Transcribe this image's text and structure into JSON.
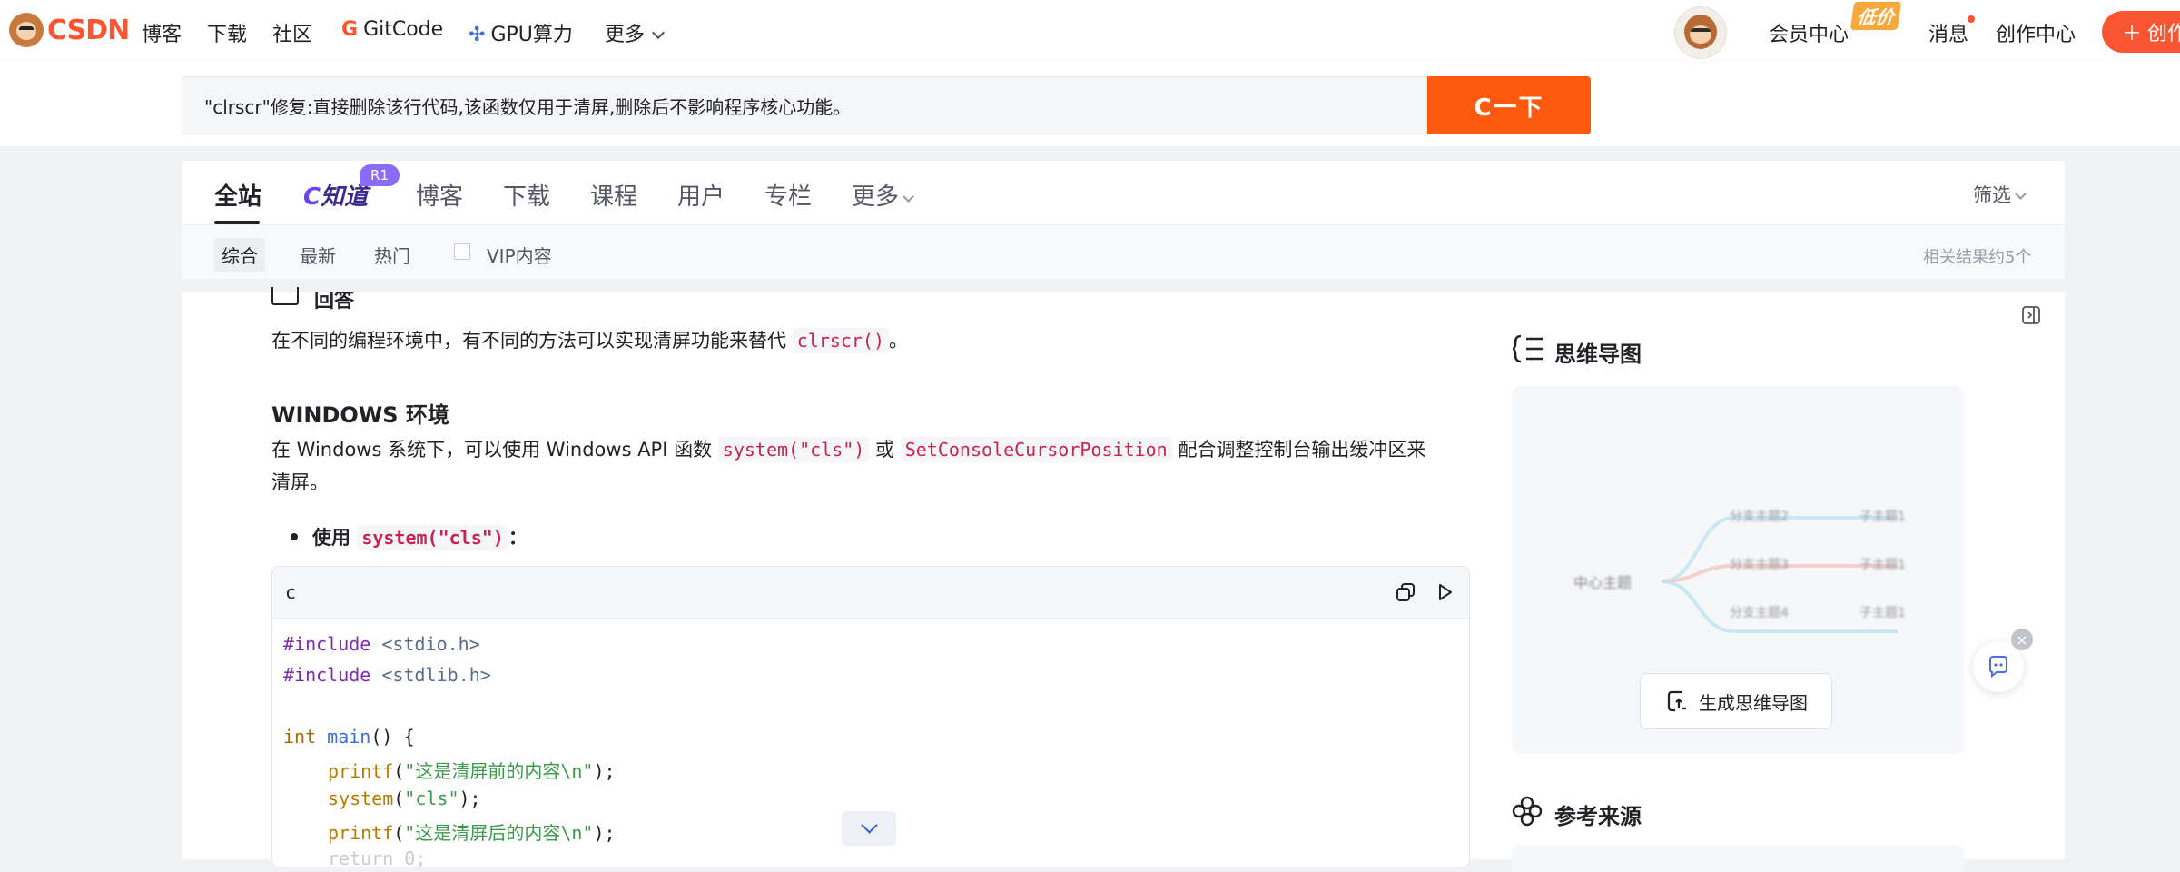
{
  "topnav": {
    "logo_text": "CSDN",
    "items": [
      "博客",
      "下载",
      "社区"
    ],
    "gitcode": "GitCode",
    "gpu": "GPU算力",
    "more": "更多",
    "member_center": "会员中心",
    "vip_badge": "低价",
    "messages": "消息",
    "creator_center": "创作中心",
    "create_button": "创作"
  },
  "search": {
    "query": "\"clrscr\"修复:直接删除该行代码,该函数仅用于清屏,删除后不影响程序核心功能。",
    "button": "C一下"
  },
  "tabs": {
    "all": "全站",
    "zhidao": "知道",
    "zhidao_badge": "R1",
    "blog": "博客",
    "download": "下载",
    "course": "课程",
    "user": "用户",
    "column": "专栏",
    "more": "更多",
    "filter": "筛选"
  },
  "subfilters": {
    "items": [
      "综合",
      "最新",
      "热门"
    ],
    "vip": "VIP内容",
    "result_count": "相关结果约5个"
  },
  "answer": {
    "heading": "回答",
    "intro_text": "在不同的编程环境中，有不同的方法可以实现清屏功能来替代",
    "intro_code": "clrscr()",
    "intro_end": "。",
    "windows_heading": "WINDOWS 环境",
    "win_p1": "在 Windows 系统下，可以使用 Windows API 函数",
    "win_code1": "system(\"cls\")",
    "win_or": "或",
    "win_code2": "SetConsoleCursorPosition",
    "win_p2": "配合调整控制台输出缓冲区来",
    "win_p3": "清屏。",
    "bullet_label": "使用",
    "bullet_code": "system(\"cls\")",
    "bullet_end": "："
  },
  "codeblock": {
    "lang": "c",
    "lines": [
      {
        "a": "#include",
        "b": " <stdio.h>"
      },
      {
        "a": "#include",
        "b": " <stdlib.h>"
      },
      {
        "ty": "int",
        "fn": "main",
        "rest": "() {"
      },
      {
        "fn": "printf",
        "p1": "(",
        "str": "\"这是清屏前的内容\\n\"",
        "p2": ");"
      },
      {
        "fn": "system",
        "p1": "(",
        "str": "\"cls\"",
        "p2": ");"
      },
      {
        "fn": "printf",
        "p1": "(",
        "str": "\"这是清屏后的内容\\n\"",
        "p2": ");"
      },
      {
        "text": "return 0;"
      }
    ]
  },
  "side": {
    "mindmap_title": "思维导图",
    "mm_center": "中心主题",
    "mm_nodes": [
      "分支主题2",
      "分支主题3",
      "分支主题4"
    ],
    "mm_leaves": [
      "子主题1",
      "子主题1",
      "子主题1"
    ],
    "generate_button": "生成思维导图",
    "ref_title": "参考来源"
  },
  "colors": {
    "brand": "#fc5531",
    "search_button": "#fc5a0e",
    "inline_code": "#c7254e"
  }
}
